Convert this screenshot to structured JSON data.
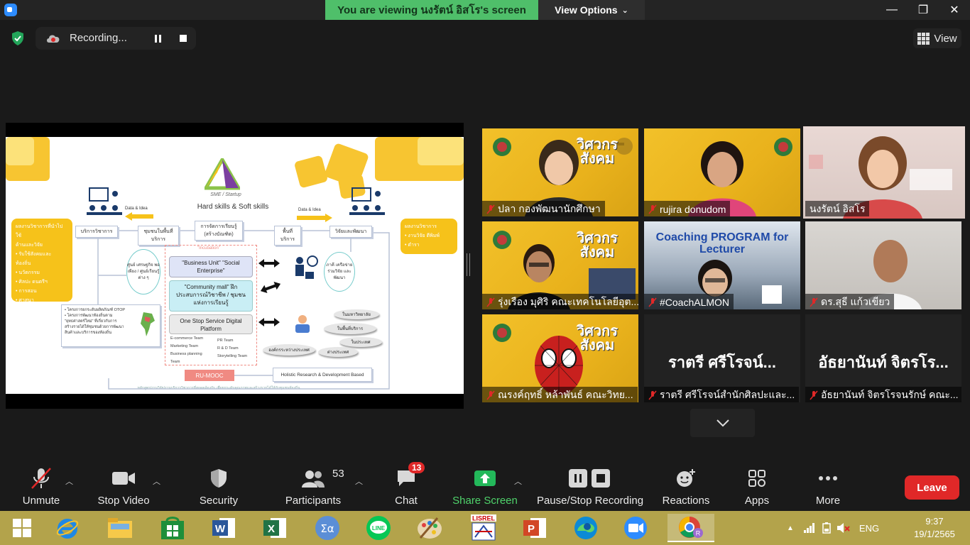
{
  "titlebar": {
    "viewing": "You are viewing นงรัตน์ อิสโร's screen",
    "view_options": "View Options",
    "minimize": "—",
    "restore": "❐",
    "close": "✕"
  },
  "topbar": {
    "recording_label": "Recording...",
    "view_label": "View"
  },
  "slide": {
    "logo_sub": "SME / Startup",
    "hard_soft": "Hard skills & Soft skills",
    "data_idea_left": "Data & Idea",
    "data_idea_right": "Data & Idea",
    "left_yellow": [
      "ผลงานวิชาการที่นำไปใช้",
      "ด้านและวิจัย",
      "• รับใช้สังคมและ",
      "  ท้องถิ่น",
      "• นวัตกรรม",
      "• ศิลปะ ดนตรีฯ",
      "• การสอน",
      "• ศาสนา"
    ],
    "right_yellow": [
      "ผลงานวิชาการ",
      "• งานวิจัย ตีพิมพ์",
      "• ตำรา"
    ],
    "academic_service": "บริการวิชาการ",
    "community_service": "ชุมชนในพื้นที่บริการ",
    "learning_mgmt": "การจัดการเรียนรู้ (สร้างบัณฑิต)",
    "service_area": "พื้นที่บริการ",
    "research_dev": "วิจัยและพัฒนา",
    "incubation": "\"Incubation\"",
    "business_unit": "\"Business Unit\" \"Social Enterprise\"",
    "community_mall": "\"Community mall\" ฝึกประสบการณ์วิชาชีพ / ชุมชนแห่งการเรียนรู้",
    "one_stop": "One Stop Service Digital Platform",
    "teams_left": [
      "E-commerce Team",
      "Marketing Team",
      "Business planning",
      "Team"
    ],
    "teams_right": [
      "PR Team",
      "R & D Team",
      "Storytelling Team"
    ],
    "economic_center": "ศูนย์ เศรษฐกิจ พอเพียง / ศูนย์เรียนรู้ ต่าง ๆ",
    "network": "ภาคี เครือข่าย ร่วมวิจัย และพัฒนา",
    "inside_uni": "ในมหาวิทยาลัย",
    "in_area": "ในพื้นที่บริการ",
    "domestic": "ในประเทศ",
    "inter_org": "องค์กรระหว่างประเทศ",
    "abroad": "ต่างประเทศ",
    "otop_lines": [
      "• โครงการยกระดับผลิตภัณฑ์ OTOP",
      "• โครงการพัฒนาท้องถิ่นตาม",
      "  \"ยุทธศาสตร์ใหม่\" ที่เกี่ยวกับการ",
      "  สร้างรายได้ให้ชุมชนด้วยการพัฒนา",
      "  สินค้าและบริการของท้องถิ่น"
    ],
    "ru_mooc": "RU-MOOC",
    "holistic": "Holistic Research & Development Based",
    "bottom_note": "หลักสูตร/งานวิจัย/งานบริการวิชาการที่สอดคล้องกับ เพื่อยกระดับคุณภาพและสร้างรายได้ให้กับชุมชนท้องถิ่น"
  },
  "tiles": [
    {
      "name": "ปลา กองพัฒนานักศึกษา",
      "muted": true
    },
    {
      "name": "rujira donudom",
      "muted": true
    },
    {
      "name": "นงรัตน์ อิสโร",
      "muted": false
    },
    {
      "name": "รุ่งเรือง มุศิริ คณะเทคโนโลยีอุต...",
      "muted": true
    },
    {
      "name": "#CoachALMON",
      "muted": true,
      "banner": "Coaching PROGRAM for Lecturer"
    },
    {
      "name": "ดร.สุธี แก้วเขียว",
      "muted": true
    },
    {
      "name": "ณรงค์ฤทธิ์ หล้าพันธ์ คณะวิทย...",
      "muted": true
    },
    {
      "name": "ราตรี ศรีโรจน์สำนักศิลปะและ...",
      "muted": true,
      "big": "ราตรี ศรีโรจน์..."
    },
    {
      "name": "อัธยานันท์ จิตรโรจนรักษ์ คณะ...",
      "muted": true,
      "big": "อัธยานันท์ จิตรโร..."
    }
  ],
  "slide_banner": {
    "line1": "วิศวกร",
    "line2": "สังคม"
  },
  "toolbar": {
    "unmute": "Unmute",
    "stop_video": "Stop Video",
    "security": "Security",
    "participants": "Participants",
    "participants_count": "53",
    "chat": "Chat",
    "chat_badge": "13",
    "share_screen": "Share Screen",
    "pause_stop": "Pause/Stop Recording",
    "reactions": "Reactions",
    "apps": "Apps",
    "more": "More",
    "leave": "Leave"
  },
  "taskbar": {
    "lang": "ENG",
    "time": "9:37",
    "date": "19/1/2565",
    "lisrel_label": "LISREL"
  },
  "colors": {
    "zoom_blue": "#2d8cff",
    "banner_green": "#4fbf6a",
    "leave_red": "#e02828",
    "active_speaker": "#c4e63b",
    "taskbar": "#b3a34b",
    "slide_yellow": "#f6c21a"
  }
}
